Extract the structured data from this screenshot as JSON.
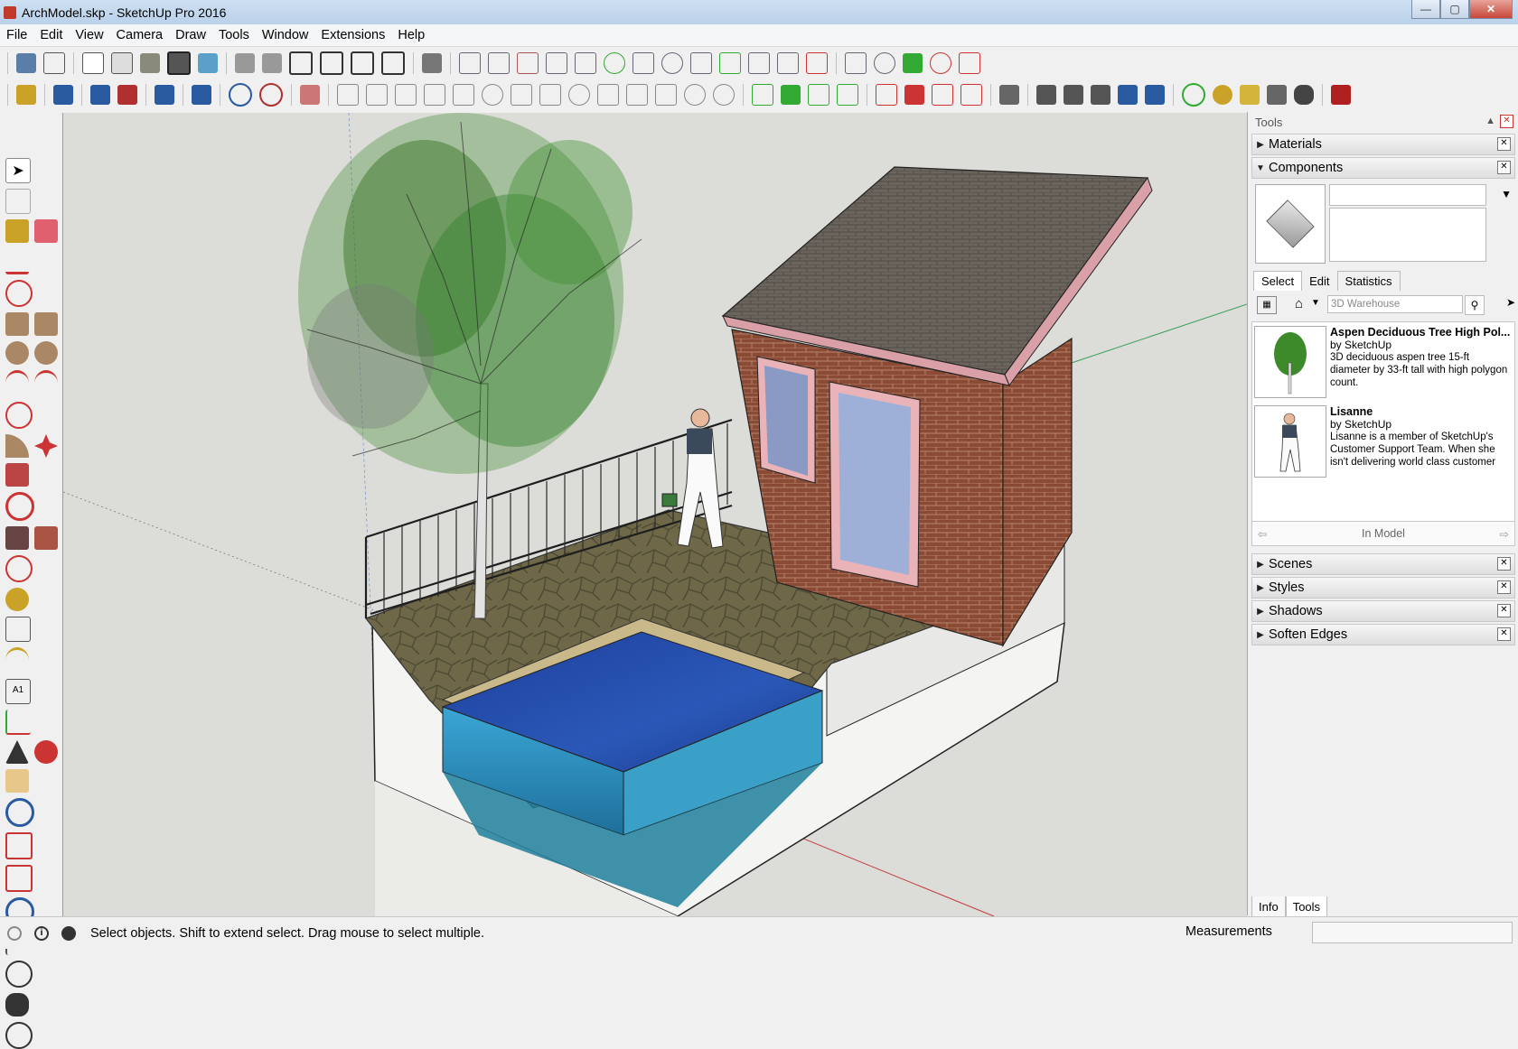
{
  "window": {
    "title": "ArchModel.skp - SketchUp Pro 2016"
  },
  "menu": [
    "File",
    "Edit",
    "View",
    "Camera",
    "Draw",
    "Tools",
    "Window",
    "Extensions",
    "Help"
  ],
  "panel": {
    "title": "Tools",
    "trays": {
      "materials": "Materials",
      "components": "Components",
      "scenes": "Scenes",
      "styles": "Styles",
      "shadows": "Shadows",
      "soften": "Soften Edges"
    },
    "tabs": [
      "Select",
      "Edit",
      "Statistics"
    ],
    "search_placeholder": "3D Warehouse",
    "results": [
      {
        "name": "Aspen Deciduous Tree High Pol...",
        "by": "by SketchUp",
        "desc": "3D deciduous aspen tree 15-ft diameter by 33-ft tall with high polygon count."
      },
      {
        "name": "Lisanne",
        "by": "by SketchUp",
        "desc": "Lisanne is a member of SketchUp's Customer Support Team. When she isn't delivering world class customer support,..."
      }
    ],
    "in_model": "In Model",
    "bottom_tabs": [
      "Info",
      "Tools"
    ]
  },
  "status": {
    "message": "Select objects. Shift to extend select. Drag mouse to select multiple.",
    "measurements_label": "Measurements"
  },
  "icons": [
    "select-icon",
    "eraser-icon",
    "paint-bucket-icon",
    "pencil-icon",
    "rectangle-icon",
    "circle-icon",
    "arc-icon",
    "move-icon",
    "rotate-icon",
    "push-pull-icon",
    "tape-measure-icon",
    "text-icon",
    "orbit-icon",
    "pan-icon",
    "zoom-icon",
    "zoom-extents-icon",
    "walk-icon",
    "look-around-icon",
    "close-icon"
  ]
}
